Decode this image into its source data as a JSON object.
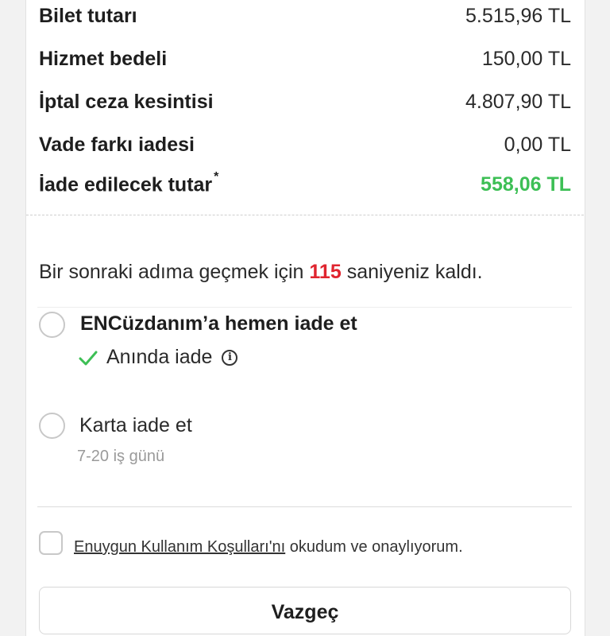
{
  "summary": {
    "rows": [
      {
        "label": "Bilet tutarı",
        "value": "5.515,96 TL"
      },
      {
        "label": "Hizmet bedeli",
        "value": "150,00 TL"
      },
      {
        "label": "İptal ceza kesintisi",
        "value": "4.807,90 TL"
      },
      {
        "label": "Vade farkı iadesi",
        "value": "0,00 TL"
      }
    ],
    "total": {
      "label": "İade edilecek tutar",
      "marker": "*",
      "value": "558,06 TL"
    }
  },
  "countdown": {
    "before": "Bir sonraki adıma geçmek için ",
    "seconds": "115",
    "after": " saniyeniz kaldı."
  },
  "options": {
    "wallet": {
      "title": "ENCüzdanım’a hemen iade et",
      "subtitle": "Anında iade",
      "selected": false
    },
    "card": {
      "title": "Karta iade et",
      "subtitle": "7-20 iş günü",
      "selected": false
    }
  },
  "terms": {
    "link": "Enuygun Kullanım Koşulları'nı",
    "text": " okudum ve onaylıyorum.",
    "checked": false
  },
  "buttons": {
    "cancel": "Vazgeç"
  },
  "colors": {
    "refund_total": "#3dbf55",
    "countdown_seconds": "#e0242f",
    "check": "#3dbf55"
  }
}
